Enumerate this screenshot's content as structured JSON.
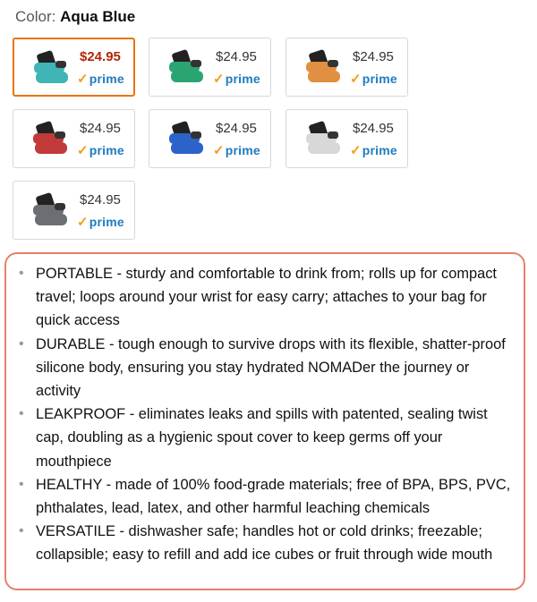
{
  "color_selector": {
    "label": "Color:",
    "selected_value": "Aqua Blue"
  },
  "swatches": [
    {
      "price": "$24.95",
      "prime": "prime",
      "body_color": "#3fb5b8",
      "selected": true
    },
    {
      "price": "$24.95",
      "prime": "prime",
      "body_color": "#2aa572",
      "selected": false
    },
    {
      "price": "$24.95",
      "prime": "prime",
      "body_color": "#e09040",
      "selected": false
    },
    {
      "price": "$24.95",
      "prime": "prime",
      "body_color": "#c23a3a",
      "selected": false
    },
    {
      "price": "$24.95",
      "prime": "prime",
      "body_color": "#2c63c9",
      "selected": false
    },
    {
      "price": "$24.95",
      "prime": "prime",
      "body_color": "#d8d8d8",
      "selected": false
    },
    {
      "price": "$24.95",
      "prime": "prime",
      "body_color": "#6b6f73",
      "selected": false
    }
  ],
  "features": [
    "PORTABLE - sturdy and comfortable to drink from; rolls up for compact travel; loops around your wrist for easy carry; attaches to your bag for quick access",
    "DURABLE - tough enough to survive drops with its flexible, shatter-proof silicone body, ensuring you stay hydrated NOMADer the journey or activity",
    "LEAKPROOF - eliminates leaks and spills with patented, sealing twist cap, doubling as a hygienic spout cover to keep germs off your mouthpiece",
    "HEALTHY - made of 100% food-grade materials; free of BPA, BPS, PVC, phthalates, lead, latex, and other harmful leaching chemicals",
    "VERSATILE - dishwasher safe; handles hot or cold drinks; freezable; collapsible; easy to refill and add ice cubes or fruit through wide mouth"
  ],
  "colors": {
    "selected_border": "#e77600",
    "selected_price": "#b12704",
    "prime_blue": "#1f7cbf",
    "prime_check": "#f59b1a",
    "highlight_border": "#e8806a"
  },
  "icons": {
    "prime_check": "checkmark-icon",
    "bullet": "bullet-icon"
  }
}
